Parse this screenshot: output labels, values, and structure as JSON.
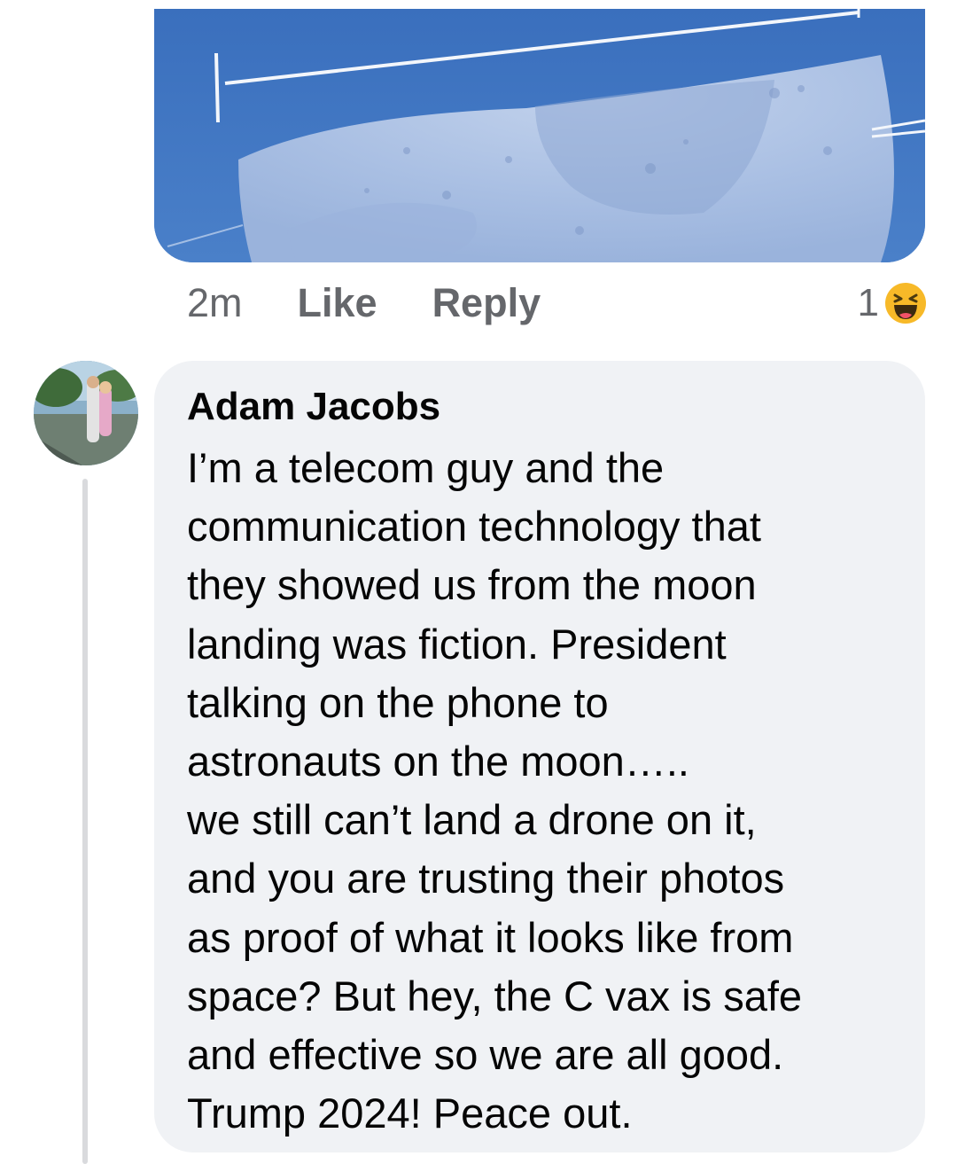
{
  "previous_comment": {
    "attachment": {
      "kind": "photo",
      "subject": "moon-photo"
    },
    "meta": {
      "time": "2m",
      "like_label": "Like",
      "reply_label": "Reply"
    },
    "reactions": {
      "count": "1",
      "icon": "laughing-emoji-icon",
      "icon_color": "#f7b928"
    }
  },
  "comment": {
    "author": "Adam Jacobs",
    "text": "I’m a telecom guy and the\ncommunication technology that\nthey showed us from the moon\nlanding was fiction. President\ntalking on the phone to\nastronauts on the moon…..\nwe still can’t land a drone on it,\nand you are trusting their photos\nas proof of what it looks like from\nspace? But hey, the C vax is safe\nand effective so we are all good.\nTrump 2024! Peace out.",
    "avatar_icon": "user-avatar"
  },
  "colors": {
    "bubble_background": "#f0f2f5",
    "meta_text": "#65676b",
    "body_text": "#050505"
  }
}
